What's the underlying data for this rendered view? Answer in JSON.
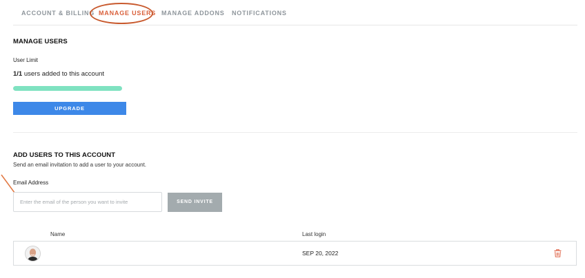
{
  "tabs": [
    {
      "label": "ACCOUNT & BILLING",
      "active": false
    },
    {
      "label": "MANAGE USERS",
      "active": true
    },
    {
      "label": "MANAGE ADDONS",
      "active": false
    },
    {
      "label": "NOTIFICATIONS",
      "active": false
    }
  ],
  "manage_users": {
    "title": "MANAGE USERS",
    "user_limit_label": "User Limit",
    "usage_count": "1/1",
    "usage_suffix": " users added to this account",
    "usage_fraction": 1.0,
    "upgrade_label": "UPGRADE"
  },
  "add_users": {
    "title": "ADD USERS TO THIS ACCOUNT",
    "subtitle": "Send an email invitation to add a user to your account.",
    "email_label": "Email Address",
    "email_placeholder": "Enter the email of the person you want to invite",
    "email_value": "",
    "invite_label": "SEND INVITE"
  },
  "users_table": {
    "columns": [
      "Name",
      "Last login"
    ],
    "rows": [
      {
        "name": "",
        "last_login": "SEP 20, 2022"
      }
    ]
  },
  "colors": {
    "accent": "#d9603b",
    "annotation": "#c8592d",
    "primary_button": "#3d88e8",
    "progress": "#7fe2c1",
    "disabled_button": "#a3abae"
  },
  "icons": {
    "delete": "trash-icon",
    "user": "avatar",
    "annotation_arrow": "arrow-icon"
  }
}
